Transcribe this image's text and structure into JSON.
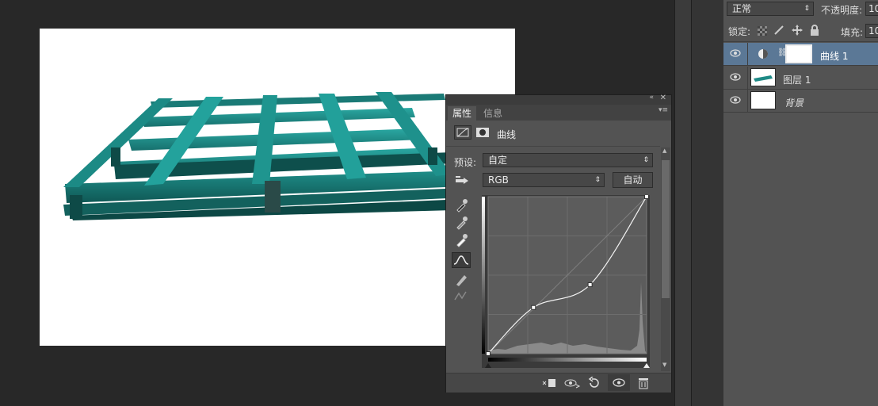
{
  "layers_panel": {
    "blend_mode": "正常",
    "opacity_label": "不透明度:",
    "opacity_value": "10",
    "lock_label": "锁定:",
    "fill_label": "填充:",
    "fill_value": "10",
    "layers": [
      {
        "name": "曲线 1",
        "selected": true
      },
      {
        "name": "图层 1",
        "selected": false
      },
      {
        "name": "背景",
        "selected": false
      }
    ]
  },
  "properties_panel": {
    "tabs": [
      "属性",
      "信息"
    ],
    "header_title": "曲线",
    "preset_label": "预设:",
    "preset_value": "自定",
    "channel_value": "RGB",
    "auto_button": "自动"
  },
  "curve": {
    "points": [
      [
        0,
        0
      ],
      [
        73,
        75
      ],
      [
        164,
        112
      ],
      [
        255,
        255
      ]
    ]
  },
  "colors": {
    "pallet": "#1e8a86",
    "panel_bg": "#535353",
    "selected_layer_bg": "#5b7896"
  }
}
